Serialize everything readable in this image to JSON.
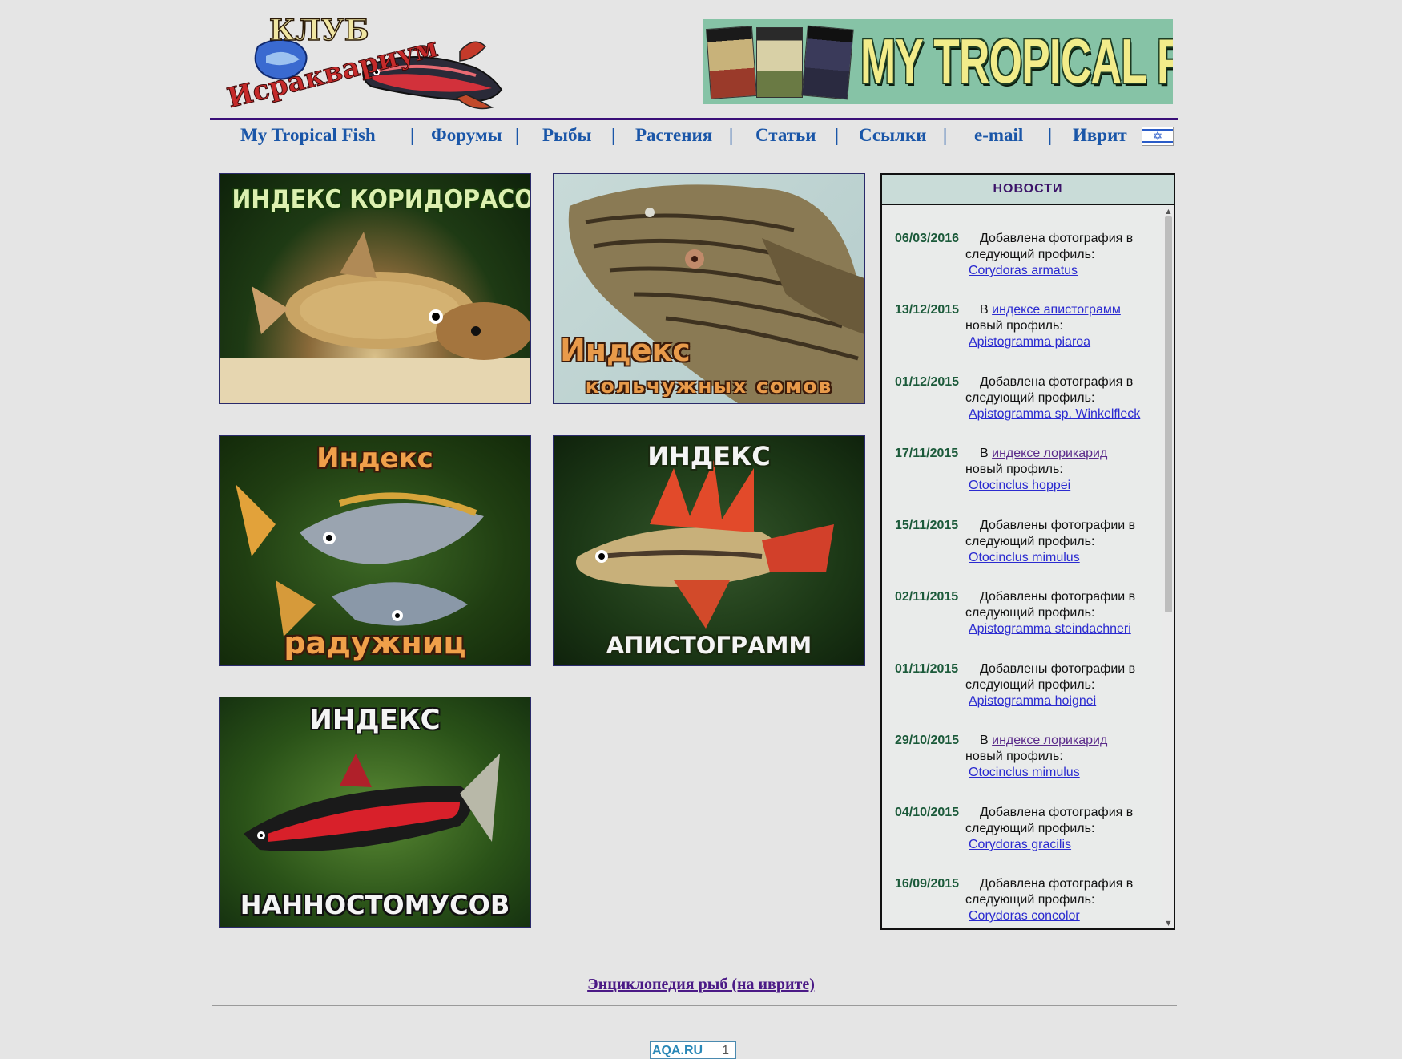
{
  "header": {
    "logo": {
      "top_text": "КЛУБ",
      "arc_text": "Исраквариум"
    },
    "banner": {
      "title": "MY TROPICAL FISH",
      "cover_text": "MY TROPICAL"
    }
  },
  "nav": {
    "items": [
      {
        "label": "My Tropical Fish"
      },
      {
        "label": "Форумы"
      },
      {
        "label": "Рыбы"
      },
      {
        "label": "Растения"
      },
      {
        "label": "Статьи"
      },
      {
        "label": "Ссылки"
      },
      {
        "label": "e-mail"
      },
      {
        "label": "Иврит"
      }
    ],
    "separator": "|",
    "flag_symbol": "✡"
  },
  "tiles": [
    {
      "id": "corydoras",
      "lines": [
        "ИНДЕКС КОРИДОРАСОВ"
      ]
    },
    {
      "id": "loricariid",
      "lines": [
        "Индекс",
        "кольчужных сомов"
      ]
    },
    {
      "id": "rainbow",
      "lines": [
        "Индекс",
        "радужниц"
      ]
    },
    {
      "id": "apisto",
      "lines": [
        "ИНДЕКС",
        "АПИСТОГРАММ"
      ]
    },
    {
      "id": "nanno",
      "lines": [
        "ИНДЕКС",
        "НАННОСТОМУСОВ"
      ]
    }
  ],
  "news": {
    "title": "НОВОСТИ",
    "items": [
      {
        "date": "06/03/2016",
        "pre": "Добавлена фотография в",
        "line2": "следующий профиль:",
        "link": "Corydoras armatus"
      },
      {
        "date": "13/12/2015",
        "pre": "В",
        "inline_link": "индексе апистограмм",
        "line2": "новый профиль:",
        "link": "Apistogramma piaroa"
      },
      {
        "date": "01/12/2015",
        "pre": "Добавлена фотография в",
        "line2": "следующий профиль:",
        "link": "Apistogramma sp. Winkelfleck"
      },
      {
        "date": "17/11/2015",
        "pre": "В",
        "inline_link": "индексе лорикарид",
        "line2": "новый профиль:",
        "link": "Otocinclus hoppei"
      },
      {
        "date": "15/11/2015",
        "pre": "Добавлены фотографии в",
        "line2": "следующий профиль:",
        "link": "Otocinclus mimulus"
      },
      {
        "date": "02/11/2015",
        "pre": "Добавлены фотографии в",
        "line2": "следующий профиль:",
        "link": "Apistogramma steindachneri"
      },
      {
        "date": "01/11/2015",
        "pre": "Добавлены фотографии в",
        "line2": "следующий профиль:",
        "link": "Apistogramma hoignei"
      },
      {
        "date": "29/10/2015",
        "pre": "В",
        "inline_link": "индексе лорикарид",
        "line2": "новый профиль:",
        "link": "Otocinclus mimulus"
      },
      {
        "date": "04/10/2015",
        "pre": "Добавлена фотография в",
        "line2": "следующий профиль:",
        "link": "Corydoras gracilis"
      },
      {
        "date": "16/09/2015",
        "pre": "Добавлена фотография в",
        "line2": "следующий профиль:",
        "link": "Corydoras concolor"
      }
    ]
  },
  "footer": {
    "encyclopedia_link": "Энциклопедия рыб (на иврите)",
    "counter_text": "AQA.RU",
    "counter_value": "1"
  }
}
